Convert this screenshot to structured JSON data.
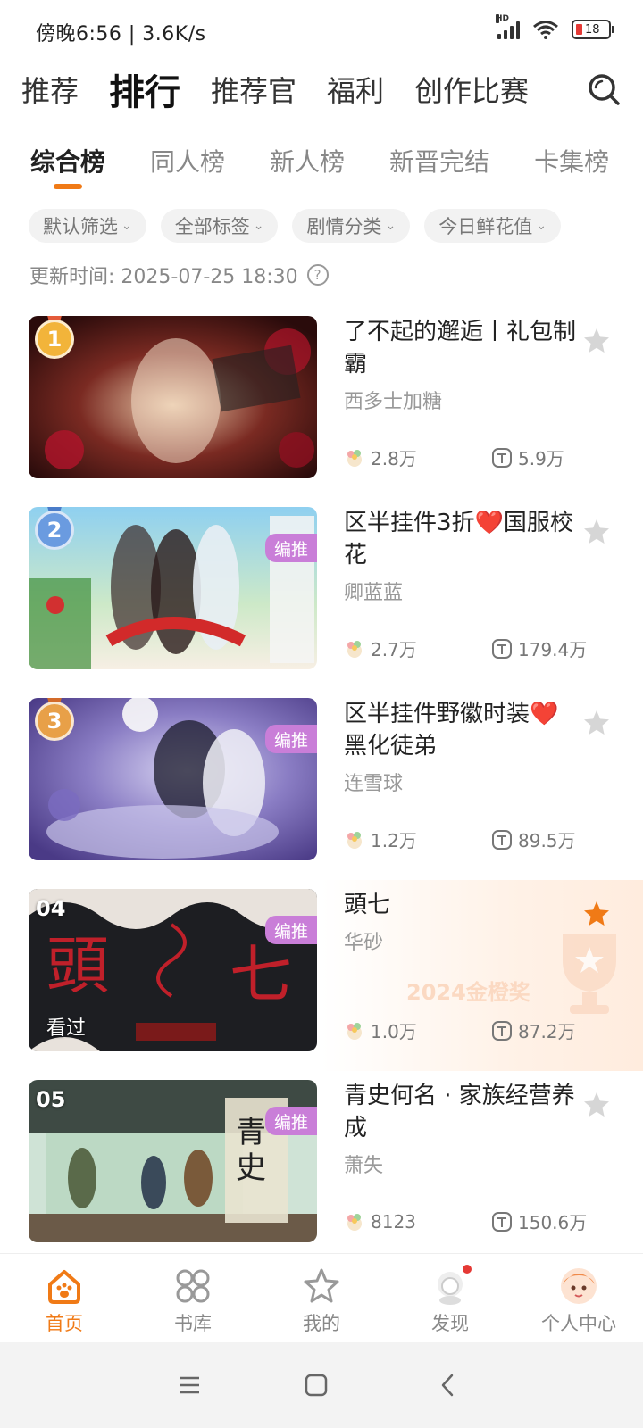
{
  "status": {
    "time": "傍晚6:56 | 3.6K/s",
    "battery": "18",
    "network": "HD"
  },
  "topnav": {
    "tabs": [
      "推荐",
      "排行",
      "推荐官",
      "福利",
      "创作比赛"
    ],
    "active": 1
  },
  "subtabs": [
    "综合榜",
    "同人榜",
    "新人榜",
    "新晋完结",
    "卡集榜"
  ],
  "filters": [
    "默认筛选",
    "全部标签",
    "剧情分类",
    "今日鲜花值"
  ],
  "update_time": "更新时间: 2025-07-25 18:30",
  "items": [
    {
      "rank": "1",
      "title": "了不起的邂逅丨礼包制霸",
      "author": "西多士加糖",
      "flowers": "2.8万",
      "t_value": "5.9万",
      "badge": "",
      "seen": "",
      "starred": false
    },
    {
      "rank": "2",
      "title": "区半挂件3折❤️国服校花",
      "author": "卿蓝蓝",
      "flowers": "2.7万",
      "t_value": "179.4万",
      "badge": "编推",
      "seen": "",
      "starred": false
    },
    {
      "rank": "3",
      "title": "区半挂件野徽时装❤️黑化徒弟",
      "author": "连雪球",
      "flowers": "1.2万",
      "t_value": "89.5万",
      "badge": "编推",
      "seen": "",
      "starred": false
    },
    {
      "rank": "04",
      "title": "頭七",
      "author": "华砂",
      "flowers": "1.0万",
      "t_value": "87.2万",
      "badge": "编推",
      "seen": "看过",
      "starred": true,
      "promo": "2024金橙奖"
    },
    {
      "rank": "05",
      "title": "青史何名 · 家族经营养成",
      "author": "萧失",
      "flowers": "8123",
      "t_value": "150.6万",
      "badge": "编推",
      "seen": "",
      "starred": false
    }
  ],
  "bottomnav": [
    "首页",
    "书库",
    "我的",
    "发现",
    "个人中心"
  ],
  "colors": {
    "accent": "#f07a16",
    "gold": "#f2b43a",
    "silver": "#6a9be0",
    "bronze": "#e8a048",
    "badge": "#c97ed8"
  }
}
